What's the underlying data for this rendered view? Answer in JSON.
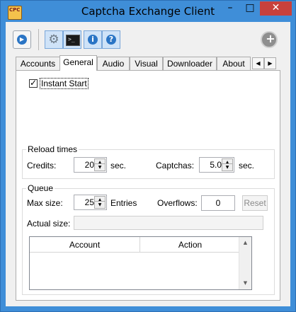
{
  "window": {
    "title": "Captcha Exchange Client",
    "app_icon_text": "CPC",
    "minimize": "–",
    "maximize": "□",
    "close": "✕"
  },
  "toolbar": {
    "play_icon": "▶",
    "info_icon": "i",
    "help_icon": "?",
    "add_icon": "+",
    "gear_icon": "⚙",
    "console_prompt": ">_"
  },
  "tabs": {
    "items": [
      "Accounts",
      "General",
      "Audio",
      "Visual",
      "Downloader",
      "About"
    ],
    "active": "General",
    "scroll_left": "◀",
    "scroll_right": "▶"
  },
  "general": {
    "instant_start": {
      "label": "Instant Start",
      "checked": true,
      "check_mark": "✓"
    }
  },
  "reload_times": {
    "title": "Reload times",
    "credits_label": "Credits:",
    "credits_value": "20",
    "credits_unit": "sec.",
    "captchas_label": "Captchas:",
    "captchas_value": "5.0",
    "captchas_unit": "sec."
  },
  "queue": {
    "title": "Queue",
    "max_size_label": "Max size:",
    "max_size_value": "25",
    "max_size_unit": "Entries",
    "overflows_label": "Overflows:",
    "overflows_value": "0",
    "reset_label": "Reset",
    "actual_size_label": "Actual size:",
    "actual_size_value": "",
    "columns": [
      "Account",
      "Action"
    ]
  },
  "spinner": {
    "up": "▲",
    "down": "▼"
  }
}
